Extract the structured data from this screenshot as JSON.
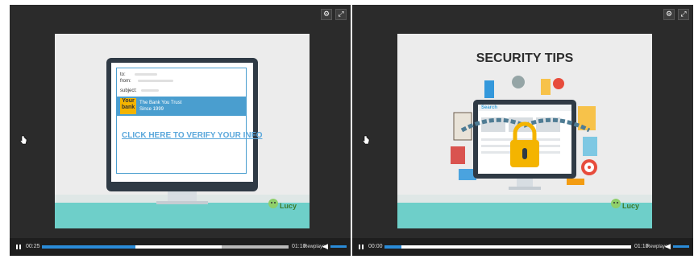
{
  "player_left": {
    "time_current": "00:25",
    "time_total": "01:10",
    "replay_label": "Rewplayer",
    "progress": 0.38,
    "buffered": 0.73,
    "slide": {
      "email": {
        "to_label": "to:",
        "from_label": "from:",
        "subject_label": "subject:",
        "bank_logo": "Your bank",
        "bank_line1": "The Bank You Trust",
        "bank_line2": "Since 1999",
        "cta": "CLICK HERE TO VERIFY YOUR INFO"
      },
      "brand": "Lucy"
    }
  },
  "player_right": {
    "time_current": "00:00",
    "time_total": "01:10",
    "replay_label": "Rewplayer",
    "progress": 0.07,
    "buffered": 0.07,
    "slide": {
      "title": "SECURITY TIPS",
      "search_logo": "Search",
      "brand": "Lucy"
    }
  },
  "colors": {
    "progress": "#2a8bd8",
    "teal_floor": "#6ecfc9",
    "padlock": "#f4b400"
  },
  "icons": {
    "play_pause": "pause-icon",
    "volume": "speaker-icon",
    "settings": "settings-icon",
    "fullscreen": "fullscreen-icon",
    "cursor": "hand-cursor-icon"
  }
}
